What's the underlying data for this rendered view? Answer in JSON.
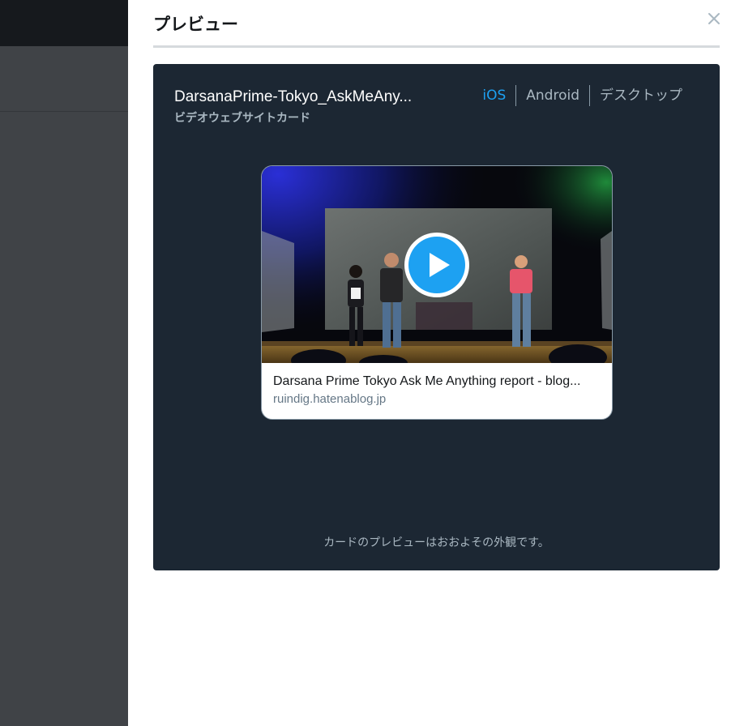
{
  "panel": {
    "title": "プレビュー",
    "close_icon": "close-icon"
  },
  "preview": {
    "card_name": "DarsanaPrime-Tokyo_AskMeAny...",
    "card_type": "ビデオウェブサイトカード",
    "tabs": [
      {
        "label": "iOS",
        "active": true
      },
      {
        "label": "Android",
        "active": false
      },
      {
        "label": "デスクトップ",
        "active": false
      }
    ],
    "card": {
      "headline": "Darsana Prime Tokyo Ask Me Anything report - blog...",
      "domain": "ruindig.hatenablog.jp",
      "media_icon": "play-icon"
    },
    "note": "カードのプレビューはおおよその外観です。"
  },
  "colors": {
    "panel_bg": "#ffffff",
    "preview_bg": "#1c2733",
    "accent": "#1da1f2",
    "muted_text": "#aab8c2",
    "backdrop": "#404347"
  }
}
